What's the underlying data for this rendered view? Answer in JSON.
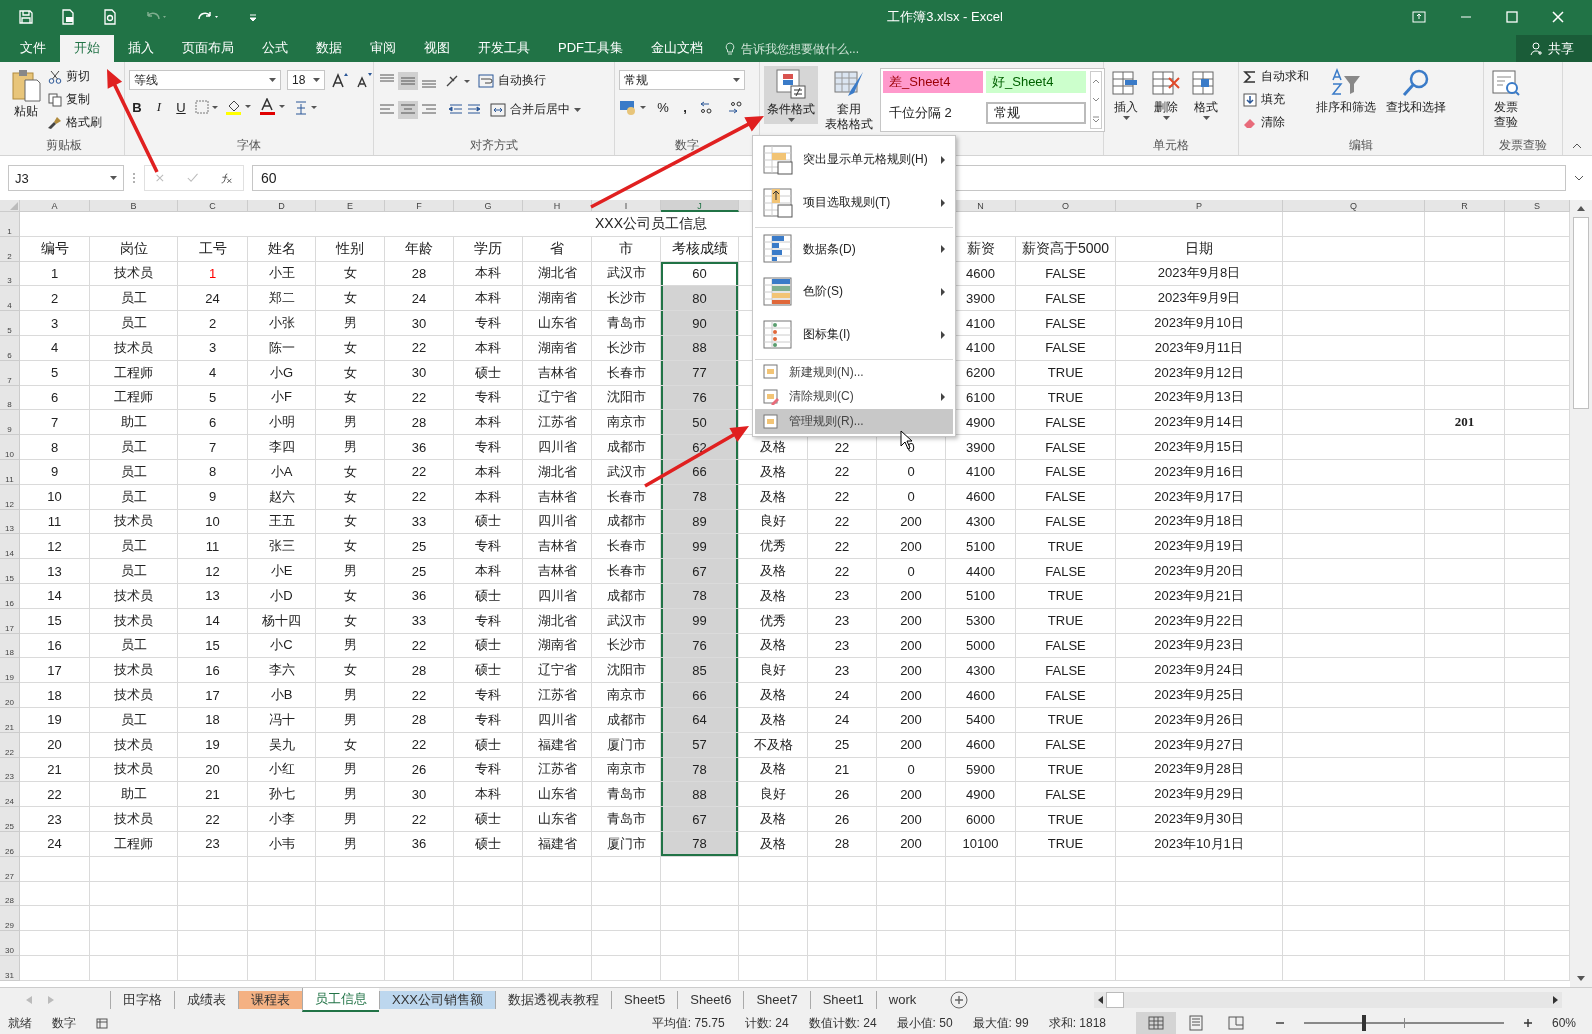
{
  "window": {
    "title": "工作簿3.xlsx - Excel"
  },
  "ribbon_tabs": [
    {
      "label": "文件",
      "selected": false
    },
    {
      "label": "开始",
      "selected": true
    },
    {
      "label": "插入",
      "selected": false
    },
    {
      "label": "页面布局",
      "selected": false
    },
    {
      "label": "公式",
      "selected": false
    },
    {
      "label": "数据",
      "selected": false
    },
    {
      "label": "审阅",
      "selected": false
    },
    {
      "label": "视图",
      "selected": false
    },
    {
      "label": "开发工具",
      "selected": false
    },
    {
      "label": "PDF工具集",
      "selected": false
    },
    {
      "label": "金山文档",
      "selected": false
    }
  ],
  "tell_me": {
    "placeholder": "告诉我您想要做什么..."
  },
  "share": "共享",
  "ribbon_groups": [
    {
      "kind": "clipboard",
      "label": "剪贴板",
      "paste": "粘贴",
      "cut": "剪切",
      "copy": "复制",
      "painter": "格式刷"
    },
    {
      "kind": "font",
      "label": "字体",
      "font": "等线",
      "size": "18",
      "bold": "B",
      "italic": "I",
      "underline": "U"
    },
    {
      "kind": "alignment",
      "label": "对齐方式",
      "wrap": "自动换行",
      "merge": "合并后居中"
    },
    {
      "kind": "number",
      "label": "数字",
      "format": "常规",
      "percent": "%",
      "comma": ","
    },
    {
      "kind": "styles",
      "conditional": "条件格式",
      "table_lines": [
        "套用",
        "表格格式"
      ],
      "cell_styles": [
        {
          "text": "差_Sheet4",
          "color": "#ff99cc",
          "selected": false
        },
        {
          "text": "好_Sheet4",
          "color": "#ccffcc",
          "selected": false
        },
        {
          "text": "千位分隔 2",
          "selected": false
        },
        {
          "text": "常规",
          "selected": true
        }
      ]
    },
    {
      "kind": "cells",
      "label": "单元格",
      "buttons": [
        "插入",
        "删除",
        "格式"
      ]
    },
    {
      "kind": "editing",
      "label": "编辑",
      "autosum": "自动求和",
      "fill": "填充",
      "clear": "清除",
      "sort": "排序和筛选",
      "find": "查找和选择"
    },
    {
      "kind": "invoice",
      "label": "发票查验",
      "button_lines": [
        "发票",
        "查验"
      ]
    }
  ],
  "formula_bar": {
    "name_box": "J3",
    "value": "60"
  },
  "columns": [
    {
      "letter": "A",
      "selected": false
    },
    {
      "letter": "B",
      "selected": false
    },
    {
      "letter": "C",
      "selected": false
    },
    {
      "letter": "D",
      "selected": false
    },
    {
      "letter": "E",
      "selected": false
    },
    {
      "letter": "F",
      "selected": false
    },
    {
      "letter": "G",
      "selected": false
    },
    {
      "letter": "H",
      "selected": false
    },
    {
      "letter": "I",
      "selected": false
    },
    {
      "letter": "J",
      "selected": true
    },
    {
      "letter": "N",
      "selected": false
    },
    {
      "letter": "O",
      "selected": false
    },
    {
      "letter": "P",
      "selected": false
    },
    {
      "letter": "Q",
      "selected": false
    },
    {
      "letter": "R",
      "selected": false
    },
    {
      "letter": "S",
      "selected": false
    }
  ],
  "sheet_title": {
    "row": "1",
    "text": "XXX公司员工信息"
  },
  "header_row": {
    "row": "2",
    "cells": [
      "编号",
      "岗位",
      "工号",
      "姓名",
      "性别",
      "年龄",
      "学历",
      "省",
      "市",
      "考核成绩",
      null,
      null,
      null,
      "薪资",
      "薪资高于5000",
      "日期"
    ]
  },
  "rows": [
    {
      "row": "3",
      "active": true,
      "cells": [
        "1",
        "技术员",
        {
          "text": "1",
          "color": "#ff0000"
        },
        "小王",
        "女",
        "28",
        "本科",
        "湖北省",
        "武汉市",
        "60",
        null,
        null,
        null,
        "4600",
        "FALSE",
        "2023年9月8日"
      ]
    },
    {
      "row": "4",
      "active": false,
      "cells": [
        "2",
        "员工",
        "24",
        "郑二",
        "女",
        "24",
        "本科",
        "湖南省",
        "长沙市",
        "80",
        null,
        null,
        null,
        "3900",
        "FALSE",
        "2023年9月9日"
      ]
    },
    {
      "row": "5",
      "active": false,
      "cells": [
        "3",
        "员工",
        "2",
        "小张",
        "男",
        "30",
        "专科",
        "山东省",
        "青岛市",
        "90",
        null,
        null,
        null,
        "4100",
        "FALSE",
        "2023年9月10日"
      ]
    },
    {
      "row": "6",
      "active": false,
      "cells": [
        "4",
        "技术员",
        "3",
        "陈一",
        "女",
        "22",
        "本科",
        "湖南省",
        "长沙市",
        "88",
        null,
        null,
        null,
        "4100",
        "FALSE",
        "2023年9月11日"
      ]
    },
    {
      "row": "7",
      "active": false,
      "cells": [
        "5",
        "工程师",
        "4",
        "小G",
        "女",
        "30",
        "硕士",
        "吉林省",
        "长春市",
        "77",
        null,
        null,
        null,
        "6200",
        "TRUE",
        "2023年9月12日"
      ]
    },
    {
      "row": "8",
      "active": false,
      "cells": [
        "6",
        "工程师",
        "5",
        "小F",
        "女",
        "22",
        "专科",
        "辽宁省",
        "沈阳市",
        "76",
        null,
        null,
        null,
        "6100",
        "TRUE",
        "2023年9月13日"
      ]
    },
    {
      "row": "9",
      "active": false,
      "cells": [
        "7",
        "助工",
        "6",
        "小明",
        "男",
        "28",
        "本科",
        "江苏省",
        "南京市",
        "50",
        null,
        null,
        null,
        "4900",
        "FALSE",
        "2023年9月14日"
      ],
      "extra": {
        "R": "201"
      }
    },
    {
      "row": "10",
      "active": false,
      "cells": [
        "8",
        "员工",
        "7",
        "李四",
        "男",
        "36",
        "专科",
        "四川省",
        "成都市",
        "62",
        "及格",
        "22",
        "0",
        "3900",
        "FALSE",
        "2023年9月15日"
      ]
    },
    {
      "row": "11",
      "active": false,
      "cells": [
        "9",
        "员工",
        "8",
        "小A",
        "女",
        "22",
        "本科",
        "湖北省",
        "武汉市",
        "66",
        "及格",
        "22",
        "0",
        "4100",
        "FALSE",
        "2023年9月16日"
      ]
    },
    {
      "row": "12",
      "active": false,
      "cells": [
        "10",
        "员工",
        "9",
        "赵六",
        "女",
        "22",
        "本科",
        "吉林省",
        "长春市",
        "78",
        "及格",
        "22",
        "0",
        "4600",
        "FALSE",
        "2023年9月17日"
      ]
    },
    {
      "row": "13",
      "active": false,
      "cells": [
        "11",
        "技术员",
        "10",
        "王五",
        "女",
        "33",
        "硕士",
        "四川省",
        "成都市",
        "89",
        "良好",
        "22",
        "200",
        "4300",
        "FALSE",
        "2023年9月18日"
      ]
    },
    {
      "row": "14",
      "active": false,
      "cells": [
        "12",
        "员工",
        "11",
        "张三",
        "女",
        "25",
        "专科",
        "吉林省",
        "长春市",
        "99",
        "优秀",
        "22",
        "200",
        "5100",
        "TRUE",
        "2023年9月19日"
      ]
    },
    {
      "row": "15",
      "active": false,
      "cells": [
        "13",
        "员工",
        "12",
        "小E",
        "男",
        "25",
        "本科",
        "吉林省",
        "长春市",
        "67",
        "及格",
        "22",
        "0",
        "4400",
        "FALSE",
        "2023年9月20日"
      ]
    },
    {
      "row": "16",
      "active": false,
      "cells": [
        "14",
        "技术员",
        "13",
        "小D",
        "女",
        "36",
        "硕士",
        "四川省",
        "成都市",
        "78",
        "及格",
        "23",
        "200",
        "5100",
        "TRUE",
        "2023年9月21日"
      ]
    },
    {
      "row": "17",
      "active": false,
      "cells": [
        "15",
        "技术员",
        "14",
        "杨十四",
        "女",
        "33",
        "专科",
        "湖北省",
        "武汉市",
        "99",
        "优秀",
        "23",
        "200",
        "5300",
        "TRUE",
        "2023年9月22日"
      ]
    },
    {
      "row": "18",
      "active": false,
      "cells": [
        "16",
        "员工",
        "15",
        "小C",
        "男",
        "22",
        "硕士",
        "湖南省",
        "长沙市",
        "76",
        "及格",
        "23",
        "200",
        "5000",
        "FALSE",
        "2023年9月23日"
      ]
    },
    {
      "row": "19",
      "active": false,
      "cells": [
        "17",
        "技术员",
        "16",
        "李六",
        "女",
        "28",
        "硕士",
        "辽宁省",
        "沈阳市",
        "85",
        "良好",
        "23",
        "200",
        "4300",
        "FALSE",
        "2023年9月24日"
      ]
    },
    {
      "row": "20",
      "active": false,
      "cells": [
        "18",
        "技术员",
        "17",
        "小B",
        "男",
        "22",
        "专科",
        "江苏省",
        "南京市",
        "66",
        "及格",
        "24",
        "200",
        "4600",
        "FALSE",
        "2023年9月25日"
      ]
    },
    {
      "row": "21",
      "active": false,
      "cells": [
        "19",
        "员工",
        "18",
        "冯十",
        "男",
        "28",
        "专科",
        "四川省",
        "成都市",
        "64",
        "及格",
        "24",
        "200",
        "5400",
        "TRUE",
        "2023年9月26日"
      ]
    },
    {
      "row": "22",
      "active": false,
      "cells": [
        "20",
        "技术员",
        "19",
        "吴九",
        "女",
        "22",
        "硕士",
        "福建省",
        "厦门市",
        "57",
        "不及格",
        "25",
        "200",
        "4600",
        "FALSE",
        "2023年9月27日"
      ]
    },
    {
      "row": "23",
      "active": false,
      "cells": [
        "21",
        "技术员",
        "20",
        "小红",
        "男",
        "26",
        "专科",
        "江苏省",
        "南京市",
        "78",
        "及格",
        "21",
        "0",
        "5900",
        "TRUE",
        "2023年9月28日"
      ]
    },
    {
      "row": "24",
      "active": false,
      "cells": [
        "22",
        "助工",
        "21",
        "孙七",
        "男",
        "30",
        "本科",
        "山东省",
        "青岛市",
        "88",
        "良好",
        "26",
        "200",
        "4900",
        "FALSE",
        "2023年9月29日"
      ]
    },
    {
      "row": "25",
      "active": false,
      "cells": [
        "23",
        "技术员",
        "22",
        "小李",
        "男",
        "22",
        "硕士",
        "山东省",
        "青岛市",
        "67",
        "及格",
        "26",
        "200",
        "6000",
        "TRUE",
        "2023年9月30日"
      ]
    },
    {
      "row": "26",
      "active": false,
      "cells": [
        "24",
        "工程师",
        "23",
        "小韦",
        "男",
        "36",
        "硕士",
        "福建省",
        "厦门市",
        "78",
        "及格",
        "28",
        "200",
        "10100",
        "TRUE",
        "2023年10月1日"
      ]
    }
  ],
  "empty_rows": [
    "27",
    "28",
    "29",
    "30",
    "31"
  ],
  "menu": [
    {
      "kind": "large",
      "label": "突出显示单元格规则(H)",
      "submenu": true,
      "group_start": false,
      "selected": false
    },
    {
      "kind": "large",
      "label": "项目选取规则(T)",
      "submenu": true,
      "group_start": false,
      "selected": false
    },
    {
      "kind": "large",
      "label": "数据条(D)",
      "submenu": true,
      "group_start": true,
      "selected": false
    },
    {
      "kind": "large",
      "label": "色阶(S)",
      "submenu": true,
      "group_start": false,
      "selected": false
    },
    {
      "kind": "large",
      "label": "图标集(I)",
      "submenu": true,
      "group_start": false,
      "selected": false
    },
    {
      "kind": "small",
      "label": "新建规则(N)...",
      "submenu": false,
      "group_start": true,
      "selected": false
    },
    {
      "kind": "small",
      "label": "清除规则(C)",
      "submenu": true,
      "group_start": false,
      "selected": false
    },
    {
      "kind": "small",
      "label": "管理规则(R)...",
      "submenu": false,
      "group_start": false,
      "selected": true
    }
  ],
  "sheet_tabs": [
    {
      "label": "田字格",
      "selected": false
    },
    {
      "label": "成绩表",
      "selected": false
    },
    {
      "label": "课程表",
      "selected": false,
      "color": "#f4b183"
    },
    {
      "label": "员工信息",
      "selected": true
    },
    {
      "label": "XXX公司销售额",
      "selected": false,
      "color": "#bdd7ee"
    },
    {
      "label": "数据透视表教程",
      "selected": false
    },
    {
      "label": "Sheet5",
      "selected": false
    },
    {
      "label": "Sheet6",
      "selected": false
    },
    {
      "label": "Sheet7",
      "selected": false
    },
    {
      "label": "Sheet1",
      "selected": false
    },
    {
      "label": "work",
      "selected": false
    }
  ],
  "status_bar": {
    "mode": "就绪",
    "num": "数字",
    "stats": [
      "平均值: 75.75",
      "计数: 24",
      "数值计数: 24",
      "最小值: 50",
      "最大值: 99",
      "求和: 1818"
    ],
    "zoom": {
      "level": 0.3,
      "reading": "60%"
    }
  }
}
